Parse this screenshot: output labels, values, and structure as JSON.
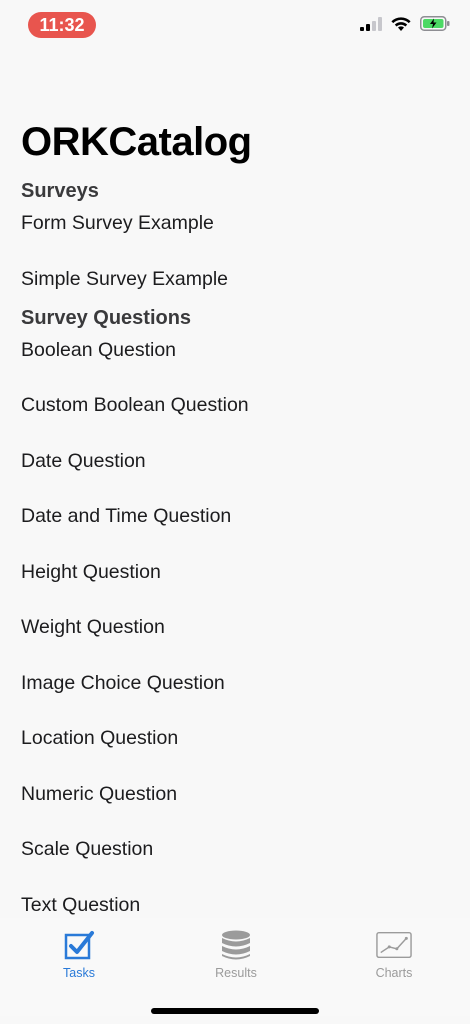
{
  "status_bar": {
    "time": "11:32"
  },
  "title": "ORKCatalog",
  "sections": [
    {
      "header": "Surveys",
      "rows": [
        "Form Survey Example",
        "Simple Survey Example"
      ]
    },
    {
      "header": "Survey Questions",
      "rows": [
        "Boolean Question",
        "Custom Boolean Question",
        "Date Question",
        "Date and Time Question",
        "Height Question",
        "Weight Question",
        "Image Choice Question",
        "Location Question",
        "Numeric Question",
        "Scale Question",
        "Text Question"
      ]
    }
  ],
  "tabs": [
    {
      "label": "Tasks",
      "icon": "checkbox-icon",
      "active": true
    },
    {
      "label": "Results",
      "icon": "database-icon",
      "active": false
    },
    {
      "label": "Charts",
      "icon": "chart-icon",
      "active": false
    }
  ],
  "colors": {
    "accent": "#2a7ad8",
    "time_pill": "#e8554e",
    "inactive": "#9b9b9b",
    "battery": "#4cd964"
  }
}
